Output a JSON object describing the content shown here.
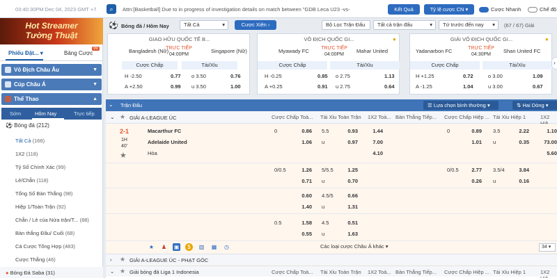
{
  "topbar": {
    "time": "03:40:30PM Dec 04, 2023 GMT +7",
    "ticker": "Attn:[Basketball] Due to in progress of investigation details on match between \"GDB Leca U23 -vs-",
    "ketqua": "Kết Quả",
    "tyle": "Tỷ lệ cược CN",
    "cuoc_nhanh": "Cược Nhanh",
    "che_do": "Chế độ"
  },
  "sidebar": {
    "banner_line1": "Hot Streamer",
    "banner_line2": "Tường Thuật",
    "tab1": "Phiếu Đặt...",
    "tab2": "Bảng Cược",
    "badge": "99",
    "head1": "Vô Địch Châu Âu",
    "head2": "Cúp Châu Á",
    "head3": "Thể Thao",
    "sub_tabs": [
      "Sớm",
      "Hôm Nay",
      "Trực tiếp"
    ],
    "sport": "Bóng đá",
    "sport_count": "(212)",
    "items": [
      {
        "label": "Tất Cả",
        "count": "(166)"
      },
      {
        "label": "1X2",
        "count": "(118)"
      },
      {
        "label": "Tỷ Số Chính Xác",
        "count": "(99)"
      },
      {
        "label": "Lẻ/Chẵn",
        "count": "(118)"
      },
      {
        "label": "Tổng Số Bàn Thắng",
        "count": "(98)"
      },
      {
        "label": "Hiệp 1/Toàn Trận",
        "count": "(92)"
      },
      {
        "label": "Chẵn / Lẻ của Nửa trận/T...",
        "count": "(88)"
      },
      {
        "label": "Bàn thắng Đầu/ Cuối",
        "count": "(68)"
      },
      {
        "label": "Cá Cược Tổng Hợp",
        "count": "(483)"
      },
      {
        "label": "Cược Thắng",
        "count": "(46)"
      }
    ],
    "saba": "Bóng Đá Saba",
    "saba_count": "(31)"
  },
  "strip": {
    "title": "Bóng đá / Hôm Nay",
    "sel_all": "Tất Cả",
    "xien": "Cược Xiên",
    "filter": "Bộ Lọc Trận Đấu",
    "all_matches": "Tất cả trận đấu",
    "order": "Tứ trước đến nay",
    "page": "(67 / 67) Giải"
  },
  "cards": [
    {
      "league": "GIAO HỮU QUỐC TẾ B...",
      "home": "Bangladesh (Nữ)",
      "away": "Singapore (Nữ)",
      "live": "TRỰC TIẾP",
      "time": "04:00PM",
      "h_label": "Cược Chấp",
      "t_label": "Tài/Xỉu",
      "r1": [
        "H",
        "-2.50",
        "0.77",
        "o",
        "3.50",
        "0.76"
      ],
      "r2": [
        "A",
        "+2.50",
        "0.99",
        "u",
        "3.50",
        "1.00"
      ]
    },
    {
      "league": "VÔ ĐỊCH QUỐC GI...",
      "home": "Myawady FC",
      "away": "Mahar United",
      "live": "TRỰC TIẾP",
      "time": "04:00PM",
      "h_label": "Cược Chấp",
      "t_label": "Tài/Xỉu",
      "r1": [
        "H",
        "-0.25",
        "0.85",
        "o",
        "2.75",
        "1.13"
      ],
      "r2": [
        "A",
        "+0.25",
        "0.91",
        "u",
        "2.75",
        "0.64"
      ]
    },
    {
      "league": "GIẢI VÔ ĐỊCH QUỐC GI...",
      "home": "Yadanarbon FC",
      "away": "Shan United FC",
      "live": "TRỰC TIẾP",
      "time": "04:30PM",
      "h_label": "Cược Chấp",
      "t_label": "Tài/Xỉu",
      "r1": [
        "H",
        "+1.25",
        "0.72",
        "o",
        "3.00",
        "1.09"
      ],
      "r2": [
        "A",
        "-1.25",
        "1.04",
        "u",
        "3.00",
        "0.67"
      ]
    }
  ],
  "table": {
    "header_label": "Trận Đấu",
    "sort": "Lựa chọn bình thường",
    "tz": "Hai Dòng",
    "columns": [
      "Cược Chấp Toà...",
      "Tài Xỉu Toàn Trận",
      "1X2 Toà...",
      "Bàn Thắng Tiếp...",
      "Cược Chấp Hiệp ...",
      "Tài Xỉu Hiệp 1",
      "1X2 Hiệ..."
    ],
    "league": "GIẢI A-LEAGUE ÚC",
    "score": "2-1",
    "period": "1H",
    "minute": "40'",
    "home": "Macarthur FC",
    "away": "Adelaide United",
    "draw": "Hòa",
    "main": {
      "hdp": [
        "0",
        "0.86",
        "",
        "1.06"
      ],
      "ou": [
        "5.5",
        "0.93",
        "u",
        "0.97"
      ],
      "x12": [
        "1.44",
        "7.00",
        "4.10"
      ],
      "h1hdp": [
        "0",
        "0.89",
        "",
        "1.01"
      ],
      "h1ou": [
        "3.5",
        "2.22",
        "u",
        "0.35"
      ],
      "h1x12": [
        "1.10",
        "73.00",
        "5.60"
      ]
    },
    "alt": [
      {
        "hl": "0/0.5",
        "h1": "1.26",
        "h2": "0.71",
        "ol": "5/5.5",
        "o1": "1.25",
        "ou": "u",
        "o2": "0.70",
        "h1l": "0/0.5",
        "hh1": "2.77",
        "hh2": "0.26",
        "h1ol": "3.5/4",
        "ho1": "3.84",
        "hou": "u",
        "ho2": "0.16"
      },
      {
        "hl": "",
        "h1": "0.60",
        "h2": "1.40",
        "ol": "4.5/5",
        "o1": "0.66",
        "ou": "u",
        "o2": "1.31"
      },
      {
        "hl": "0.5",
        "h1": "1.58",
        "h2": "0.55",
        "ol": "4.5",
        "o1": "0.51",
        "ou": "u",
        "o2": "1.63"
      }
    ],
    "more": "Các loại cược Châu Á khác",
    "page_num": "34",
    "footer_league1": "GIẢI A-LEAGUE ÚC - PHẠT GÓC",
    "footer_league2": "Giải bóng đá Liga 1 Indonesia"
  }
}
